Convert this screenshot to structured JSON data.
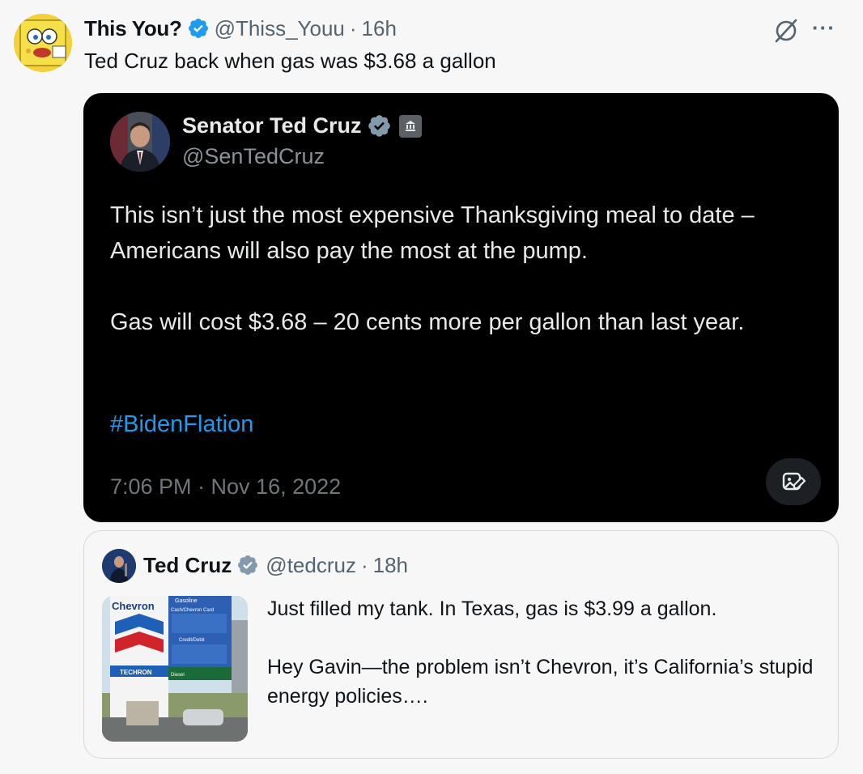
{
  "tweet": {
    "author_name": "This You?",
    "handle": "@Thiss_Youu",
    "separator": "·",
    "time": "16h",
    "text": "Ted Cruz back when gas was $3.68 a gallon",
    "more_label": "···"
  },
  "screenshot": {
    "author_name": "Senator Ted Cruz",
    "handle": "@SenTedCruz",
    "body": "This isn’t just the most expensive Thanksgiving meal to date – Americans will also pay the most at the pump.\n\nGas will cost $3.68 – 20 cents more per gallon than last year.",
    "hashtag": "#BidenFlation",
    "timestamp": "7:06 PM · Nov 16, 2022"
  },
  "quote": {
    "author_name": "Ted Cruz",
    "handle": "@tedcruz",
    "separator": "·",
    "time": "18h",
    "text": "Just filled my tank. In Texas, gas is $3.99 a gallon.\n\nHey Gavin—the problem isn’t Chevron, it’s California’s stupid energy policies….",
    "image": {
      "brand": "Chevron",
      "sign_gasoline": "Gasoline",
      "sign_card": "Cash/Chevron Card",
      "sign_credit": "Credit/Debit",
      "sign_diesel": "Diesel",
      "sign_techron": "TECHRON"
    }
  },
  "colors": {
    "verified": "#1d9bf0",
    "verified_gray": "#829aab",
    "link": "#1d9bf0",
    "muted": "#536471"
  },
  "icons": {
    "verified": "verified-badge-icon",
    "grok": "grok-icon",
    "more": "more-dots-icon",
    "gov": "government-building-icon",
    "edit_image": "image-edit-icon"
  }
}
